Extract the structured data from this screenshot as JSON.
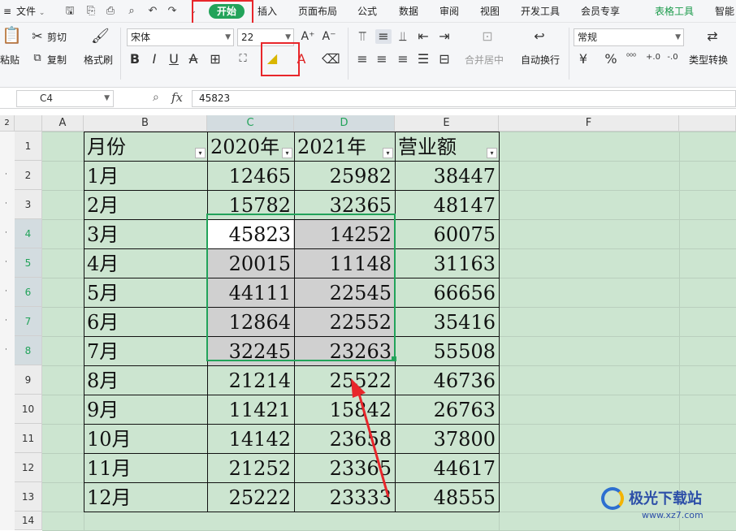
{
  "menubar": {
    "file_label": "文件",
    "start_tab": "开始",
    "tabs": [
      "插入",
      "页面布局",
      "公式",
      "数据",
      "审阅",
      "视图",
      "开发工具",
      "会员专享",
      "表格工具",
      "智能"
    ]
  },
  "ribbon": {
    "paste_label": "粘贴",
    "cut_label": "剪切",
    "copy_label": "复制",
    "format_painter_label": "格式刷",
    "font_name": "宋体",
    "font_size": "22",
    "merge_label": "合并居中",
    "wrap_label": "自动换行",
    "number_format": "常规",
    "type_convert_label": "类型转换",
    "currency_symbol": "¥",
    "percent_symbol": "%"
  },
  "formula_bar": {
    "cell_ref": "C4",
    "fx_label": "fx",
    "value": "45823"
  },
  "grid": {
    "columns": [
      "A",
      "B",
      "C",
      "D",
      "E",
      "F"
    ],
    "rows": [
      "1",
      "2",
      "3",
      "4",
      "5",
      "6",
      "7",
      "8",
      "9",
      "10",
      "11",
      "12",
      "13",
      "14"
    ],
    "outline_level": "2",
    "headers": [
      "月份",
      "2020年",
      "2021年",
      "营业额"
    ],
    "data": [
      [
        "1月",
        "12465",
        "25982",
        "38447"
      ],
      [
        "2月",
        "15782",
        "32365",
        "48147"
      ],
      [
        "3月",
        "45823",
        "14252",
        "60075"
      ],
      [
        "4月",
        "20015",
        "11148",
        "31163"
      ],
      [
        "5月",
        "44111",
        "22545",
        "66656"
      ],
      [
        "6月",
        "12864",
        "22552",
        "35416"
      ],
      [
        "7月",
        "32245",
        "23263",
        "55508"
      ],
      [
        "8月",
        "21214",
        "25522",
        "46736"
      ],
      [
        "9月",
        "11421",
        "15842",
        "26763"
      ],
      [
        "10月",
        "14142",
        "23658",
        "37800"
      ],
      [
        "11月",
        "21252",
        "23365",
        "44617"
      ],
      [
        "12月",
        "25222",
        "23333",
        "48555"
      ]
    ]
  },
  "colors": {
    "accent": "#22a35a",
    "sheet_fill": "#cce5d0",
    "highlight_fill": "#d0d0d0",
    "annotation_red": "#e8262b"
  },
  "watermark": {
    "brand": "极光下载站",
    "url": "www.xz7.com"
  }
}
